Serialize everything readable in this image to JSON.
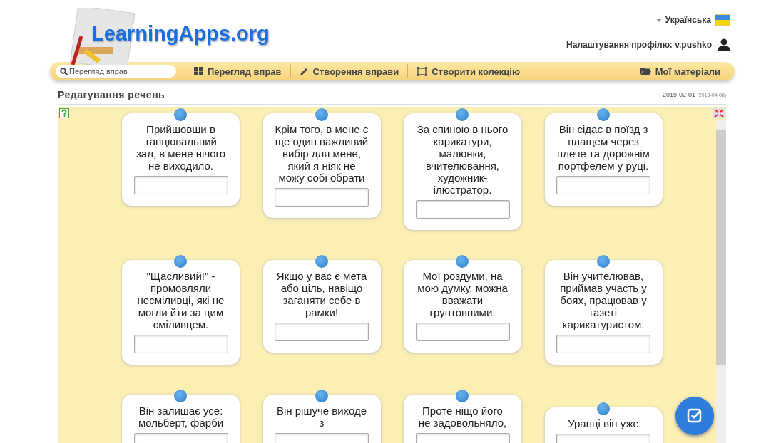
{
  "header": {
    "logo": "LearningApps.org",
    "language": "Українська",
    "profile": "Налаштування профілю: v.pushko"
  },
  "nav": {
    "search": {
      "placeholder": "Перегляд вправ"
    },
    "items": [
      {
        "label": "Перегляд вправ"
      },
      {
        "label": "Створення вправи"
      },
      {
        "label": "Створити колекцію"
      }
    ],
    "right": {
      "label": "Мої матеріали"
    }
  },
  "page": {
    "title": "Редагування речень",
    "date": "2019-02-01",
    "date_created": "(2018-04-08)"
  },
  "cards": [
    {
      "text": "Прийшовши в танцювальний зал, в мене нічого не виходило."
    },
    {
      "text": "Крім того, в мене є ще один важливий вибір для мене, який я ніяк не можу собі обрати"
    },
    {
      "text": "За спиною в нього карикатури, малюнки, вчителювання, художник-ілюстратор."
    },
    {
      "text": "Він сідає в поїзд з плащем через плече та дорожнім портфелем у руці."
    },
    {
      "text": "\"Щасливий!\" - промовляли несміливці, які не могли йти за цим сміливцем."
    },
    {
      "text": "Якщо у вас є мета або ціль, навіщо заганяти себе в рамки!"
    },
    {
      "text": "Мої роздуми, на мою думку, можна вважати грунтовними."
    },
    {
      "text": "Він учителював, приймав участь у боях, працював у газеті карикатуристом."
    },
    {
      "text": "Він залишає усе: мольберт, фарби"
    },
    {
      "text": "Він рішуче виходе з"
    },
    {
      "text": "Проте ніщо його не задовольняло,"
    },
    {
      "text": "Уранці він уже"
    }
  ]
}
